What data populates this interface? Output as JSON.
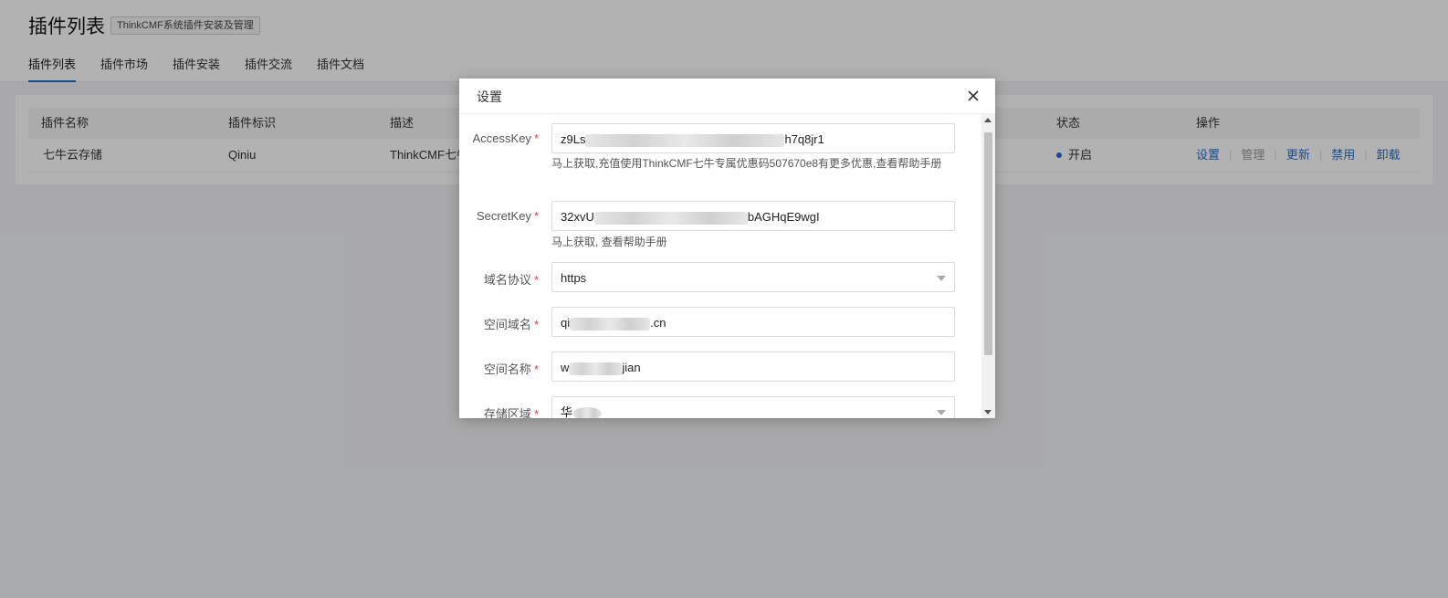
{
  "header": {
    "title": "插件列表",
    "subtitle": "ThinkCMF系统插件安装及管理",
    "tabs": [
      "插件列表",
      "插件市场",
      "插件安装",
      "插件交流",
      "插件文档"
    ],
    "active_tab": 0
  },
  "table": {
    "columns": [
      "插件名称",
      "插件标识",
      "描述",
      "状态",
      "操作"
    ],
    "rows": [
      {
        "name": "七牛云存储",
        "identifier": "Qiniu",
        "description": "ThinkCMF七牛",
        "status": "开启",
        "actions": [
          "设置",
          "管理",
          "更新",
          "禁用",
          "卸载"
        ]
      }
    ]
  },
  "modal": {
    "title": "设置",
    "fields": [
      {
        "label": "AccessKey",
        "required": "*",
        "value_start": "z9Ls",
        "value_end": "h7q8jr1",
        "help": "马上获取,充值使用ThinkCMF七牛专属优惠码507670e8有更多优惠,查看帮助手册"
      },
      {
        "label": "SecretKey",
        "required": "*",
        "value_start": "32xvU",
        "value_end": "bAGHqE9wgI",
        "help": "马上获取, 查看帮助手册"
      },
      {
        "label": "域名协议",
        "required": "*",
        "value": "https",
        "type": "select"
      },
      {
        "label": "空间域名",
        "required": "*",
        "value_start": "qi",
        "value_end": ".cn"
      },
      {
        "label": "空间名称",
        "required": "*",
        "value_start": "w",
        "value_end": "jian"
      },
      {
        "label": "存储区域",
        "required": "*",
        "value_start": "华",
        "type": "select"
      }
    ]
  },
  "colors": {
    "accent": "#1f6fd1",
    "required": "#e53935"
  }
}
